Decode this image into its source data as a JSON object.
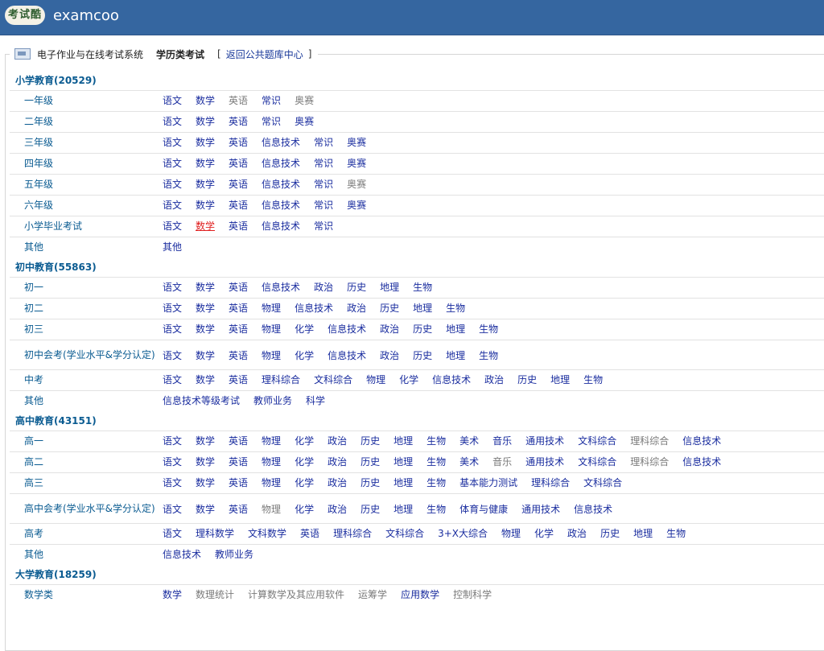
{
  "header": {
    "logo_seal": "考试酷",
    "logo_text": "examcoo"
  },
  "nav": {
    "system": "电子作业与在线考试系统",
    "current": "学历类考试",
    "bracket_open": "[",
    "bracket_close": "]",
    "back_link": "返回公共题库中心"
  },
  "colors": {
    "header": "#3566a0",
    "category": "#0a5b91",
    "link": "#1a2d9f",
    "inactive": "#7a7a7a",
    "active": "#e02020"
  },
  "sections": [
    {
      "title": "小学教育(20529)",
      "rows": [
        {
          "label": "一年级",
          "items": [
            {
              "t": "语文"
            },
            {
              "t": "数学"
            },
            {
              "t": "英语",
              "s": "dim"
            },
            {
              "t": "常识"
            },
            {
              "t": "奥赛",
              "s": "dim"
            }
          ]
        },
        {
          "label": "二年级",
          "items": [
            {
              "t": "语文"
            },
            {
              "t": "数学"
            },
            {
              "t": "英语"
            },
            {
              "t": "常识"
            },
            {
              "t": "奥赛"
            }
          ]
        },
        {
          "label": "三年级",
          "items": [
            {
              "t": "语文"
            },
            {
              "t": "数学"
            },
            {
              "t": "英语"
            },
            {
              "t": "信息技术"
            },
            {
              "t": "常识"
            },
            {
              "t": "奥赛"
            }
          ]
        },
        {
          "label": "四年级",
          "items": [
            {
              "t": "语文"
            },
            {
              "t": "数学"
            },
            {
              "t": "英语"
            },
            {
              "t": "信息技术"
            },
            {
              "t": "常识"
            },
            {
              "t": "奥赛"
            }
          ]
        },
        {
          "label": "五年级",
          "items": [
            {
              "t": "语文"
            },
            {
              "t": "数学"
            },
            {
              "t": "英语"
            },
            {
              "t": "信息技术"
            },
            {
              "t": "常识"
            },
            {
              "t": "奥赛",
              "s": "dim"
            }
          ]
        },
        {
          "label": "六年级",
          "items": [
            {
              "t": "语文"
            },
            {
              "t": "数学"
            },
            {
              "t": "英语"
            },
            {
              "t": "信息技术"
            },
            {
              "t": "常识"
            },
            {
              "t": "奥赛"
            }
          ]
        },
        {
          "label": "小学毕业考试",
          "items": [
            {
              "t": "语文"
            },
            {
              "t": "数学",
              "s": "hot"
            },
            {
              "t": "英语"
            },
            {
              "t": "信息技术"
            },
            {
              "t": "常识"
            }
          ]
        },
        {
          "label": "其他",
          "items": [
            {
              "t": "其他"
            }
          ]
        }
      ]
    },
    {
      "title": "初中教育(55863)",
      "rows": [
        {
          "label": "初一",
          "items": [
            {
              "t": "语文"
            },
            {
              "t": "数学"
            },
            {
              "t": "英语"
            },
            {
              "t": "信息技术"
            },
            {
              "t": "政治"
            },
            {
              "t": "历史"
            },
            {
              "t": "地理"
            },
            {
              "t": "生物"
            }
          ]
        },
        {
          "label": "初二",
          "items": [
            {
              "t": "语文"
            },
            {
              "t": "数学"
            },
            {
              "t": "英语"
            },
            {
              "t": "物理"
            },
            {
              "t": "信息技术"
            },
            {
              "t": "政治"
            },
            {
              "t": "历史"
            },
            {
              "t": "地理"
            },
            {
              "t": "生物"
            }
          ]
        },
        {
          "label": "初三",
          "items": [
            {
              "t": "语文"
            },
            {
              "t": "数学"
            },
            {
              "t": "英语"
            },
            {
              "t": "物理"
            },
            {
              "t": "化学"
            },
            {
              "t": "信息技术"
            },
            {
              "t": "政治"
            },
            {
              "t": "历史"
            },
            {
              "t": "地理"
            },
            {
              "t": "生物"
            }
          ]
        },
        {
          "label": "初中会考(学业水平&学分认定)",
          "double": true,
          "items": [
            {
              "t": "语文"
            },
            {
              "t": "数学"
            },
            {
              "t": "英语"
            },
            {
              "t": "物理"
            },
            {
              "t": "化学"
            },
            {
              "t": "信息技术"
            },
            {
              "t": "政治"
            },
            {
              "t": "历史"
            },
            {
              "t": "地理"
            },
            {
              "t": "生物"
            }
          ]
        },
        {
          "label": "中考",
          "items": [
            {
              "t": "语文"
            },
            {
              "t": "数学"
            },
            {
              "t": "英语"
            },
            {
              "t": "理科综合"
            },
            {
              "t": "文科综合"
            },
            {
              "t": "物理"
            },
            {
              "t": "化学"
            },
            {
              "t": "信息技术"
            },
            {
              "t": "政治"
            },
            {
              "t": "历史"
            },
            {
              "t": "地理"
            },
            {
              "t": "生物"
            }
          ]
        },
        {
          "label": "其他",
          "items": [
            {
              "t": "信息技术等级考试"
            },
            {
              "t": "教师业务"
            },
            {
              "t": "科学"
            }
          ]
        }
      ]
    },
    {
      "title": "高中教育(43151)",
      "rows": [
        {
          "label": "高一",
          "items": [
            {
              "t": "语文"
            },
            {
              "t": "数学"
            },
            {
              "t": "英语"
            },
            {
              "t": "物理"
            },
            {
              "t": "化学"
            },
            {
              "t": "政治"
            },
            {
              "t": "历史"
            },
            {
              "t": "地理"
            },
            {
              "t": "生物"
            },
            {
              "t": "美术"
            },
            {
              "t": "音乐"
            },
            {
              "t": "通用技术"
            },
            {
              "t": "文科综合"
            },
            {
              "t": "理科综合",
              "s": "dim"
            },
            {
              "t": "信息技术"
            }
          ]
        },
        {
          "label": "高二",
          "items": [
            {
              "t": "语文"
            },
            {
              "t": "数学"
            },
            {
              "t": "英语"
            },
            {
              "t": "物理"
            },
            {
              "t": "化学"
            },
            {
              "t": "政治"
            },
            {
              "t": "历史"
            },
            {
              "t": "地理"
            },
            {
              "t": "生物"
            },
            {
              "t": "美术"
            },
            {
              "t": "音乐",
              "s": "dim"
            },
            {
              "t": "通用技术"
            },
            {
              "t": "文科综合"
            },
            {
              "t": "理科综合",
              "s": "dim"
            },
            {
              "t": "信息技术"
            }
          ]
        },
        {
          "label": "高三",
          "items": [
            {
              "t": "语文"
            },
            {
              "t": "数学"
            },
            {
              "t": "英语"
            },
            {
              "t": "物理"
            },
            {
              "t": "化学"
            },
            {
              "t": "政治"
            },
            {
              "t": "历史"
            },
            {
              "t": "地理"
            },
            {
              "t": "生物"
            },
            {
              "t": "基本能力测试"
            },
            {
              "t": "理科综合"
            },
            {
              "t": "文科综合"
            }
          ]
        },
        {
          "label": "高中会考(学业水平&学分认定)",
          "double": true,
          "items": [
            {
              "t": "语文"
            },
            {
              "t": "数学"
            },
            {
              "t": "英语"
            },
            {
              "t": "物理",
              "s": "dim"
            },
            {
              "t": "化学"
            },
            {
              "t": "政治"
            },
            {
              "t": "历史"
            },
            {
              "t": "地理"
            },
            {
              "t": "生物"
            },
            {
              "t": "体育与健康"
            },
            {
              "t": "通用技术"
            },
            {
              "t": "信息技术"
            }
          ]
        },
        {
          "label": "高考",
          "items": [
            {
              "t": "语文"
            },
            {
              "t": "理科数学"
            },
            {
              "t": "文科数学"
            },
            {
              "t": "英语"
            },
            {
              "t": "理科综合"
            },
            {
              "t": "文科综合"
            },
            {
              "t": "3+X大综合"
            },
            {
              "t": "物理"
            },
            {
              "t": "化学"
            },
            {
              "t": "政治"
            },
            {
              "t": "历史"
            },
            {
              "t": "地理"
            },
            {
              "t": "生物"
            }
          ]
        },
        {
          "label": "其他",
          "items": [
            {
              "t": "信息技术"
            },
            {
              "t": "教师业务"
            }
          ]
        }
      ]
    },
    {
      "title": "大学教育(18259)",
      "rows": [
        {
          "label": "数学类",
          "items": [
            {
              "t": "数学"
            },
            {
              "t": "数理统计",
              "s": "dim"
            },
            {
              "t": "计算数学及其应用软件",
              "s": "dim"
            },
            {
              "t": "运筹学",
              "s": "dim"
            },
            {
              "t": "应用数学"
            },
            {
              "t": "控制科学",
              "s": "dim"
            }
          ]
        }
      ]
    }
  ]
}
